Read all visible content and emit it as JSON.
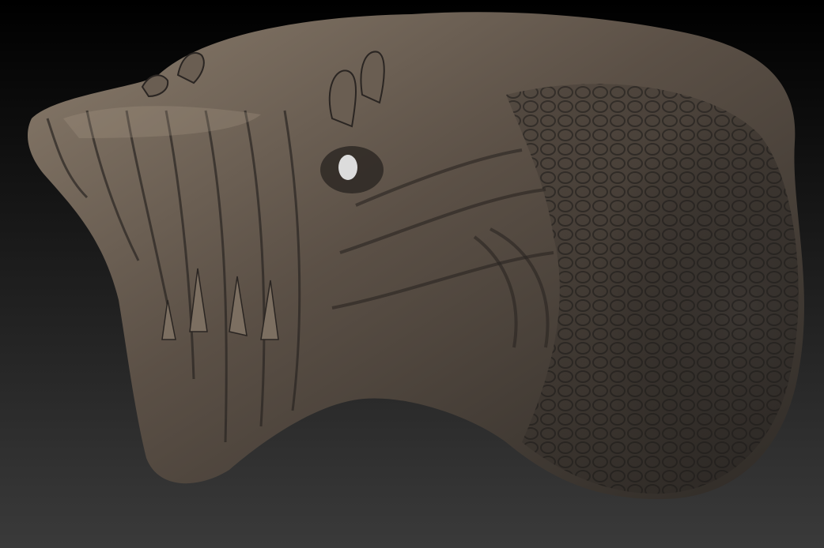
{
  "scene": {
    "subject": "sculpted-creature-head",
    "background_top_color": "#000000",
    "background_bottom_color": "#3a3a3a",
    "skin_dark_color": "#2e2a26",
    "skin_mid_color": "#5b5046",
    "skin_light_color": "#8a7c6c",
    "eye_color": "#dcdcdc"
  }
}
